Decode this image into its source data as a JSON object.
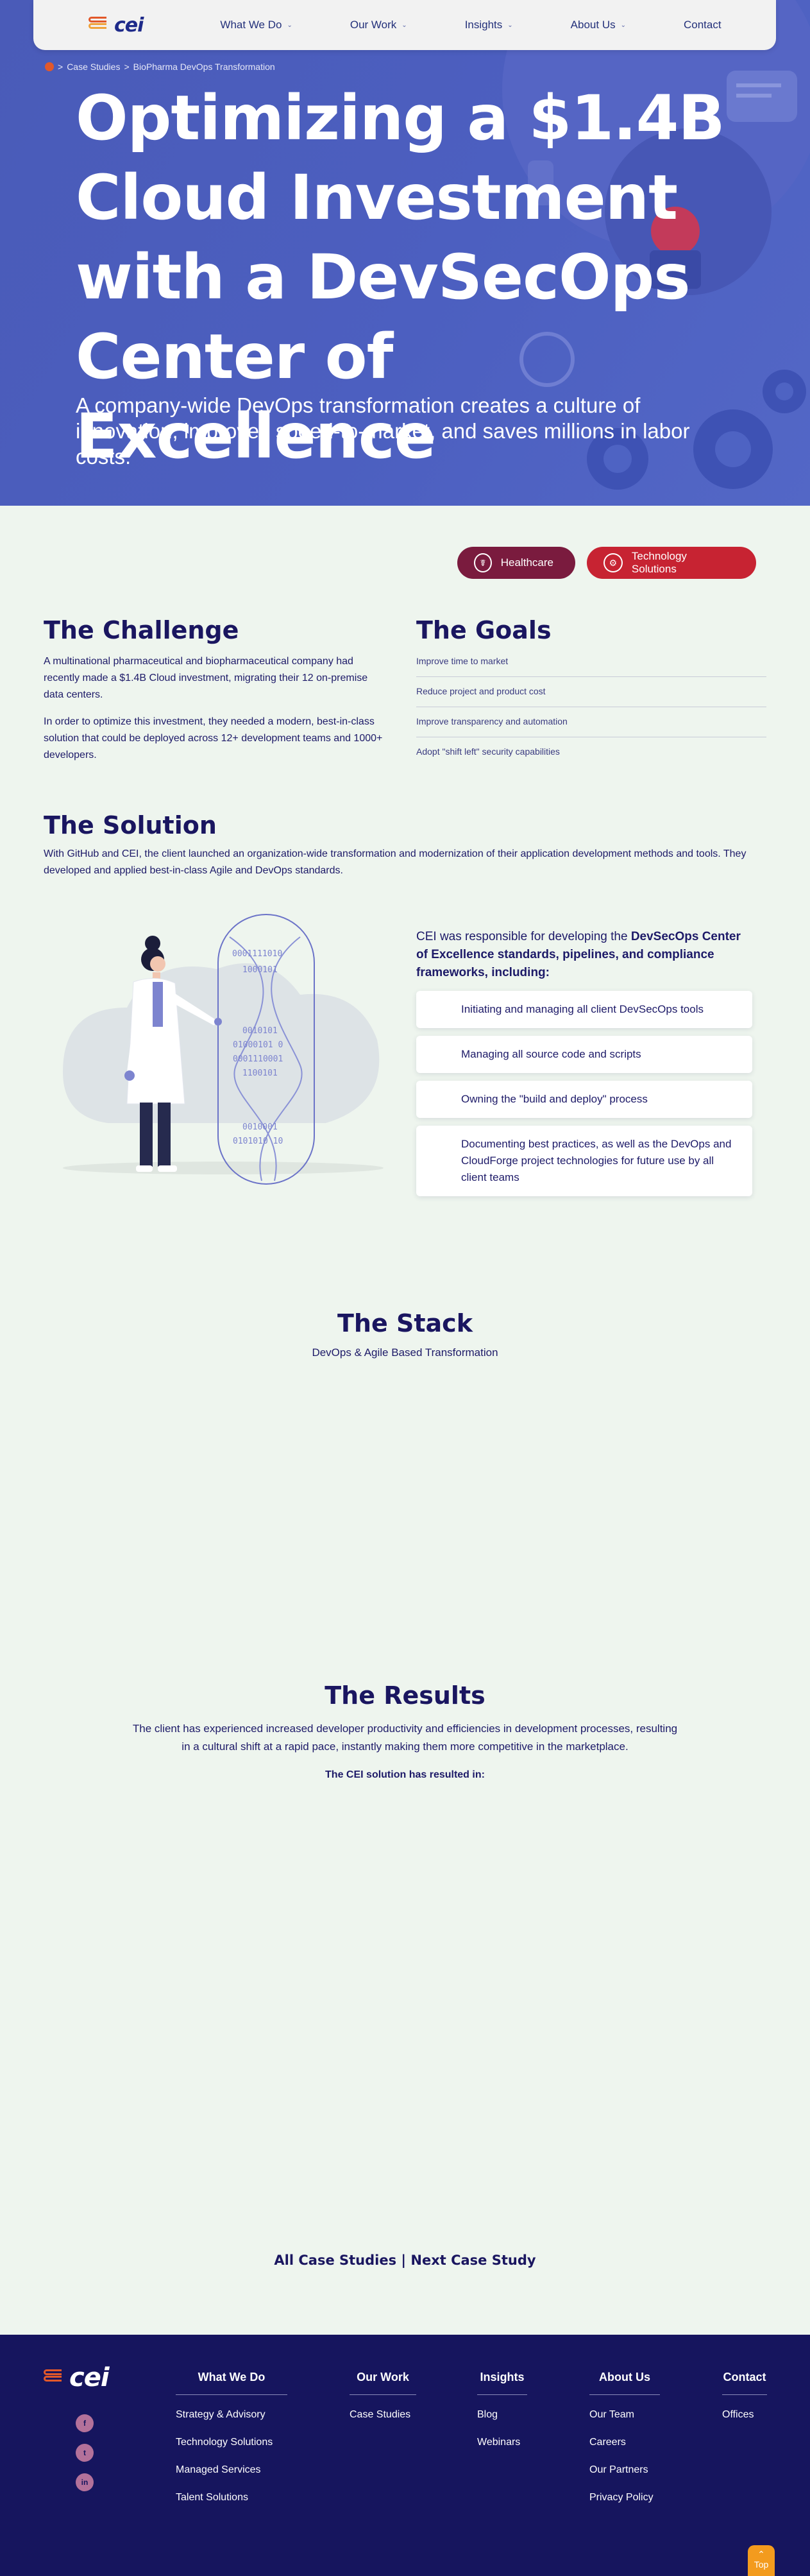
{
  "nav": {
    "logo_text": "cei",
    "items": [
      "What We Do",
      "Our Work",
      "Insights",
      "About Us",
      "Contact"
    ]
  },
  "breadcrumb": {
    "items": [
      "Case Studies",
      "BioPharma DevOps Transformation"
    ],
    "sep": ">"
  },
  "hero": {
    "title": "Optimizing a $1.4B Cloud Investment with a DevSecOps Center of Excellence",
    "subtitle": "A company-wide DevOps transformation creates a culture of innovation, improves speed-to-market, and saves millions in labor costs."
  },
  "tags": [
    "Healthcare",
    "Technology Solutions"
  ],
  "challenge": {
    "heading": "The Challenge",
    "p1": "A multinational pharmaceutical and biopharmaceutical company had recently made a $1.4B Cloud investment, migrating their 12 on-premise data centers.",
    "p2": "In order to optimize this investment, they needed a modern, best-in-class solution that could be deployed across 12+ development teams and 1000+ developers."
  },
  "goals": {
    "heading": "The Goals",
    "items": [
      "Improve time to market",
      "Reduce project and product cost",
      "Improve transparency and automation",
      "Adopt \"shift left\" security capabilities"
    ]
  },
  "solution": {
    "heading": "The Solution",
    "p": "With GitHub and CEI, the client launched an organization-wide transformation and modernization of their application development methods and tools. They developed and applied best-in-class Agile and DevOps standards.",
    "resp_intro_plain": "CEI was responsible for developing the ",
    "resp_intro_bold": "DevSecOps Center of Excellence standards, pipelines, and compliance frameworks, including:",
    "cards": [
      "Initiating and managing all client DevSecOps tools",
      "Managing all source code and scripts",
      "Owning the \"build and deploy\" process",
      "Documenting best practices, as well as the DevOps and CloudForge project technologies for future use by all client teams"
    ],
    "binary": [
      "0001111010",
      "1000101",
      "0010101",
      "01000101 0",
      "0001110001",
      "1100101",
      "0010001",
      "0101010 10"
    ]
  },
  "stack": {
    "heading": "The Stack",
    "sub": "DevOps & Agile Based Transformation"
  },
  "results": {
    "heading": "The Results",
    "p": "The client has experienced increased developer productivity and efficiencies in development processes, resulting in a cultural shift at a rapid pace, instantly making them more competitive in the marketplace.",
    "lead": "The CEI solution has resulted in:"
  },
  "case_links": {
    "all": "All Case Studies",
    "sep": " | ",
    "next": "Next Case Study"
  },
  "footer": {
    "logo_text": "cei",
    "socials": [
      "f",
      "t",
      "in"
    ],
    "columns": [
      {
        "heading": "What We Do",
        "items": [
          "Strategy & Advisory",
          "Technology Solutions",
          "Managed Services",
          "Talent Solutions"
        ]
      },
      {
        "heading": "Our Work",
        "items": [
          "Case Studies"
        ]
      },
      {
        "heading": "Insights",
        "items": [
          "Blog",
          "Webinars"
        ]
      },
      {
        "heading": "About Us",
        "items": [
          "Our Team",
          "Careers",
          "Our Partners",
          "Privacy Policy"
        ]
      },
      {
        "heading": "Contact",
        "items": [
          "Offices"
        ]
      }
    ],
    "top_label": "Top"
  },
  "colors": {
    "hero_bg": "#4c5fc0",
    "navy": "#1a1660",
    "healthcare_tag": "#7a1b3e",
    "tech_tag": "#c72332",
    "footer_bg": "#16155e",
    "accent_orange": "#f39b1e"
  }
}
